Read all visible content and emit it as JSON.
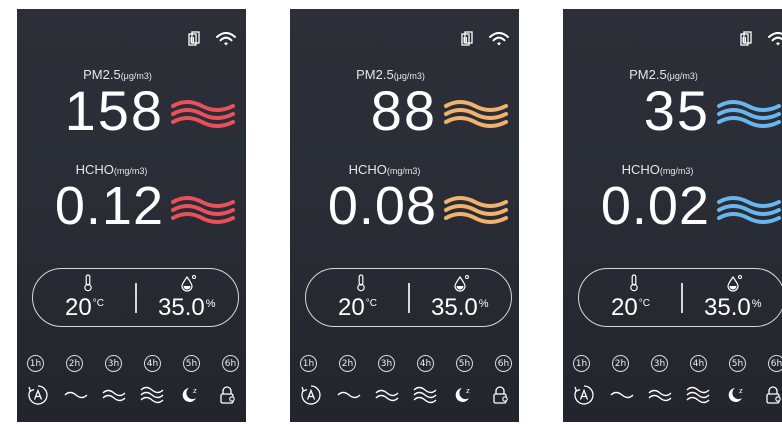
{
  "colors": {
    "high": "#e8505b",
    "mid": "#f0b36e",
    "low": "#68b6f0",
    "background": "#2b2e36"
  },
  "panels": [
    {
      "pm_label": "PM2.5",
      "pm_unit": "(μg/m3)",
      "pm_value": "158",
      "pm_level_color": "#e8505b",
      "hcho_label": "HCHO",
      "hcho_unit": "(mg/m3)",
      "hcho_value": "0.12",
      "hcho_level_color": "#e8505b",
      "temperature": "20",
      "temperature_unit": "°C",
      "humidity": "35.0",
      "humidity_unit": "%"
    },
    {
      "pm_label": "PM2.5",
      "pm_unit": "(μg/m3)",
      "pm_value": "88",
      "pm_level_color": "#f0b36e",
      "hcho_label": "HCHO",
      "hcho_unit": "(mg/m3)",
      "hcho_value": "0.08",
      "hcho_level_color": "#f0b36e",
      "temperature": "20",
      "temperature_unit": "°C",
      "humidity": "35.0",
      "humidity_unit": "%"
    },
    {
      "pm_label": "PM2.5",
      "pm_unit": "(μg/m3)",
      "pm_value": "35",
      "pm_level_color": "#68b6f0",
      "hcho_label": "HCHO",
      "hcho_unit": "(mg/m3)",
      "hcho_value": "0.02",
      "hcho_level_color": "#68b6f0",
      "temperature": "20",
      "temperature_unit": "°C",
      "humidity": "35.0",
      "humidity_unit": "%"
    }
  ],
  "timers": [
    "1h",
    "2h",
    "3h",
    "4h",
    "5h",
    "6h"
  ],
  "modes": [
    "auto-mode-icon",
    "fan-low-icon",
    "fan-medium-icon",
    "fan-high-icon",
    "sleep-mode-icon",
    "child-lock-icon"
  ]
}
